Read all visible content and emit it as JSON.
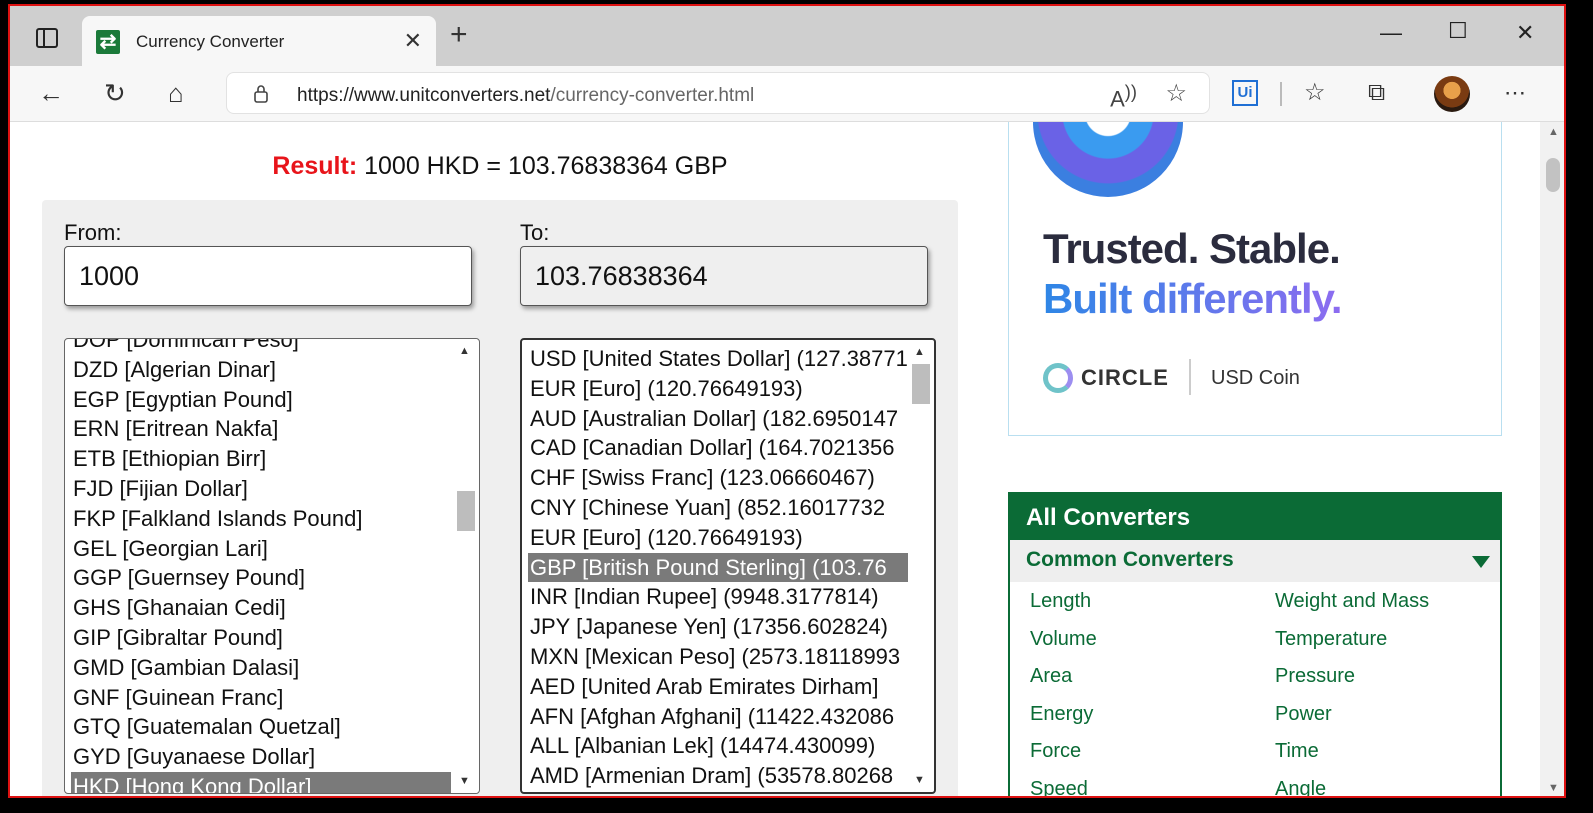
{
  "browser": {
    "tab_title": "Currency Converter",
    "favicon_glyph": "⇄",
    "url_main": "https://www.unitconverters.net",
    "url_path": "/currency-converter.html",
    "ui_badge": "Ui"
  },
  "result": {
    "label": "Result:",
    "text": "1000 HKD = 103.76838364 GBP"
  },
  "from": {
    "label": "From:",
    "value": "1000"
  },
  "to": {
    "label": "To:",
    "value": "103.76838364"
  },
  "from_list": {
    "items": [
      "DOP [Dominican Peso]",
      "DZD [Algerian Dinar]",
      "EGP [Egyptian Pound]",
      "ERN [Eritrean Nakfa]",
      "ETB [Ethiopian Birr]",
      "FJD [Fijian Dollar]",
      "FKP [Falkland Islands Pound]",
      "GEL [Georgian Lari]",
      "GGP [Guernsey Pound]",
      "GHS [Ghanaian Cedi]",
      "GIP [Gibraltar Pound]",
      "GMD [Gambian Dalasi]",
      "GNF [Guinean Franc]",
      "GTQ [Guatemalan Quetzal]",
      "GYD [Guyanaese Dollar]",
      "HKD [Hong Kong Dollar]"
    ],
    "selected": "HKD [Hong Kong Dollar]"
  },
  "to_list": {
    "items": [
      "USD [United States Dollar] (127.38771",
      "EUR [Euro] (120.76649193)",
      "AUD [Australian Dollar] (182.6950147",
      "CAD [Canadian Dollar] (164.7021356",
      "CHF [Swiss Franc] (123.06660467)",
      "CNY [Chinese Yuan] (852.16017732",
      "EUR [Euro] (120.76649193)",
      "GBP [British Pound Sterling] (103.76",
      "INR [Indian Rupee] (9948.3177814)",
      "JPY [Japanese Yen] (17356.602824)",
      "MXN [Mexican Peso] (2573.18118993",
      "AED [United Arab Emirates Dirham]",
      "AFN [Afghan Afghani] (11422.432086",
      "ALL [Albanian Lek] (14474.430099)",
      "AMD [Armenian Dram] (53578.80268"
    ],
    "selected": "GBP [British Pound Sterling] (103.76"
  },
  "ad": {
    "line1": "Trusted. Stable.",
    "line2": "Built differently.",
    "brand": "CIRCLE",
    "brand2": "USD Coin"
  },
  "converters": {
    "title": "All Converters",
    "subtitle": "Common Converters",
    "links": [
      "Length",
      "Weight and Mass",
      "Volume",
      "Temperature",
      "Area",
      "Pressure",
      "Energy",
      "Power",
      "Force",
      "Time",
      "Speed",
      "Angle"
    ]
  },
  "colors": {
    "result_label": "#e8141a",
    "brand_green": "#0b6b36",
    "selection_gray": "#7a7a7a"
  },
  "icons": [
    "sidebar-icon",
    "close-icon",
    "plus-icon",
    "minimize-icon",
    "maximize-icon",
    "back-icon",
    "refresh-icon",
    "home-icon",
    "lock-icon",
    "read-aloud-icon",
    "add-favorite-icon",
    "favorites-icon",
    "collections-icon",
    "more-icon"
  ]
}
